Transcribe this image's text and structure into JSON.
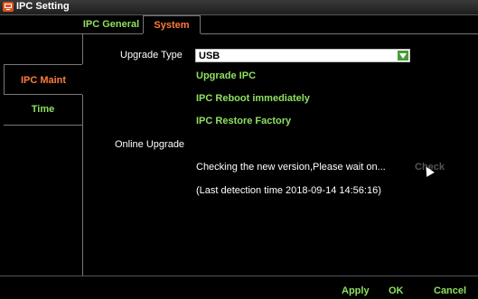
{
  "window": {
    "title": "IPC Setting",
    "icon": "ipc-setting-icon"
  },
  "tabs": [
    {
      "label": "IPC General",
      "active": false
    },
    {
      "label": "System",
      "active": true
    }
  ],
  "sidebar": {
    "items": [
      {
        "label": "IPC Maint",
        "active": true
      },
      {
        "label": "Time",
        "active": false
      }
    ]
  },
  "upgrade_type": {
    "label": "Upgrade Type",
    "value": "USB"
  },
  "actions": {
    "upgrade_ipc": "Upgrade IPC",
    "reboot": "IPC Reboot immediately",
    "restore": "IPC Restore Factory"
  },
  "online_upgrade": {
    "label": "Online Upgrade",
    "status": "Checking the new version,Please wait on...",
    "check_label": "Check",
    "last_detection": "(Last detection time 2018-09-14 14:56:16)"
  },
  "footer": {
    "apply": "Apply",
    "ok": "OK",
    "cancel": "Cancel"
  },
  "colors": {
    "accent_orange": "#ff7b3a",
    "accent_green": "#8fe060",
    "background": "#000000"
  }
}
